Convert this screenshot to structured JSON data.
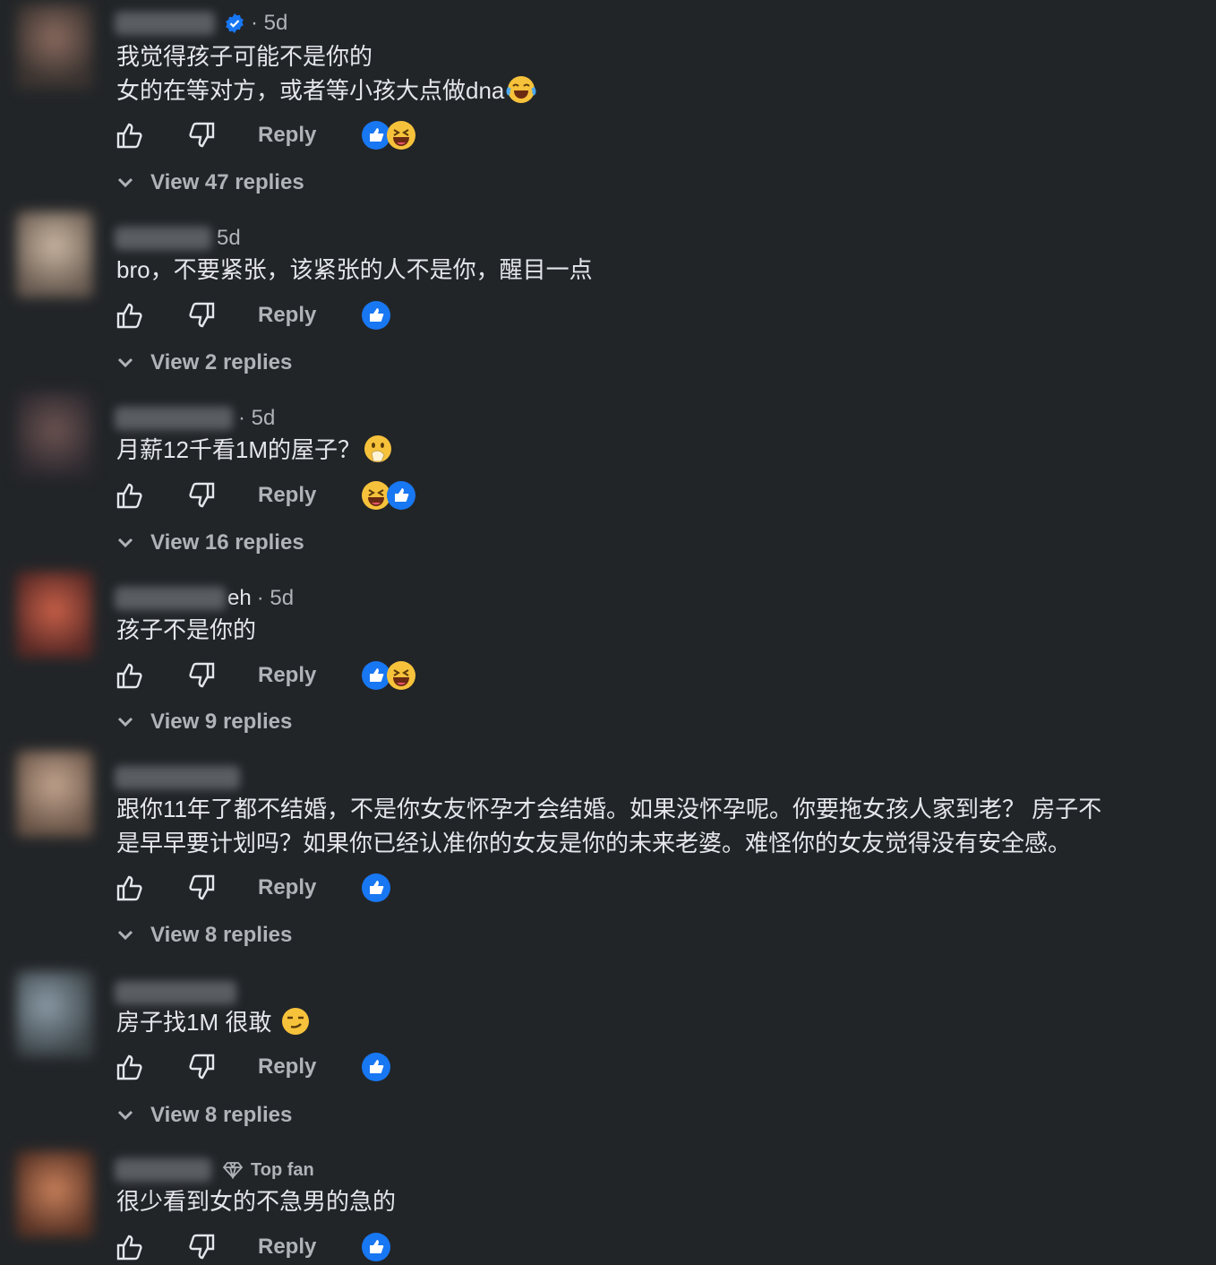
{
  "colors": {
    "background": "#222528",
    "text": "#e4e6eb",
    "muted": "#b0b3b8",
    "like_blue": "#1877f2",
    "verified_blue": "#1877f2"
  },
  "comments": [
    {
      "name_tail": "",
      "verified": true,
      "time": "· 5d",
      "lines": [
        "我觉得孩子可能不是你的",
        "女的在等对方，或者等小孩大点做dna"
      ],
      "line_emoji": "joy",
      "reactions": [
        "like",
        "laugh"
      ],
      "reply_label": "Reply",
      "view_replies": "View 47 replies"
    },
    {
      "name_tail": "",
      "time": "5d",
      "lines": [
        "bro，不要紧张，该紧张的人不是你，醒目一点"
      ],
      "reactions": [
        "like"
      ],
      "reply_label": "Reply",
      "view_replies": "View 2 replies"
    },
    {
      "name_tail": "",
      "time": "· 5d",
      "lines": [
        "月薪12千看1M的屋子？"
      ],
      "line_emoji": "hand-over-mouth",
      "reactions": [
        "laugh",
        "like"
      ],
      "reply_label": "Reply",
      "view_replies": "View 16 replies"
    },
    {
      "name_tail": "eh",
      "time": "· 5d",
      "lines": [
        "孩子不是你的"
      ],
      "reactions": [
        "like",
        "laugh"
      ],
      "reply_label": "Reply",
      "view_replies": "View 9 replies"
    },
    {
      "name_tail": "",
      "time": "",
      "lines": [
        "跟你11年了都不结婚，不是你女友怀孕才会结婚。如果没怀孕呢。你要拖女孩人家到老？ 房子不",
        "是早早要计划吗？如果你已经认准你的女友是你的未来老婆。难怪你的女友觉得没有安全感。"
      ],
      "reactions": [
        "like"
      ],
      "reply_label": "Reply",
      "view_replies": "View 8 replies"
    },
    {
      "name_tail": "",
      "time": "",
      "lines": [
        "房子找1M 很敢 "
      ],
      "line_emoji": "smirk",
      "reactions": [
        "like"
      ],
      "reply_label": "Reply",
      "view_replies": "View 8 replies"
    },
    {
      "name_tail": "",
      "time": "",
      "top_fan": "Top fan",
      "lines": [
        "很少看到女的不急男的急的"
      ],
      "reactions": [
        "like"
      ],
      "reply_label": "Reply"
    }
  ]
}
